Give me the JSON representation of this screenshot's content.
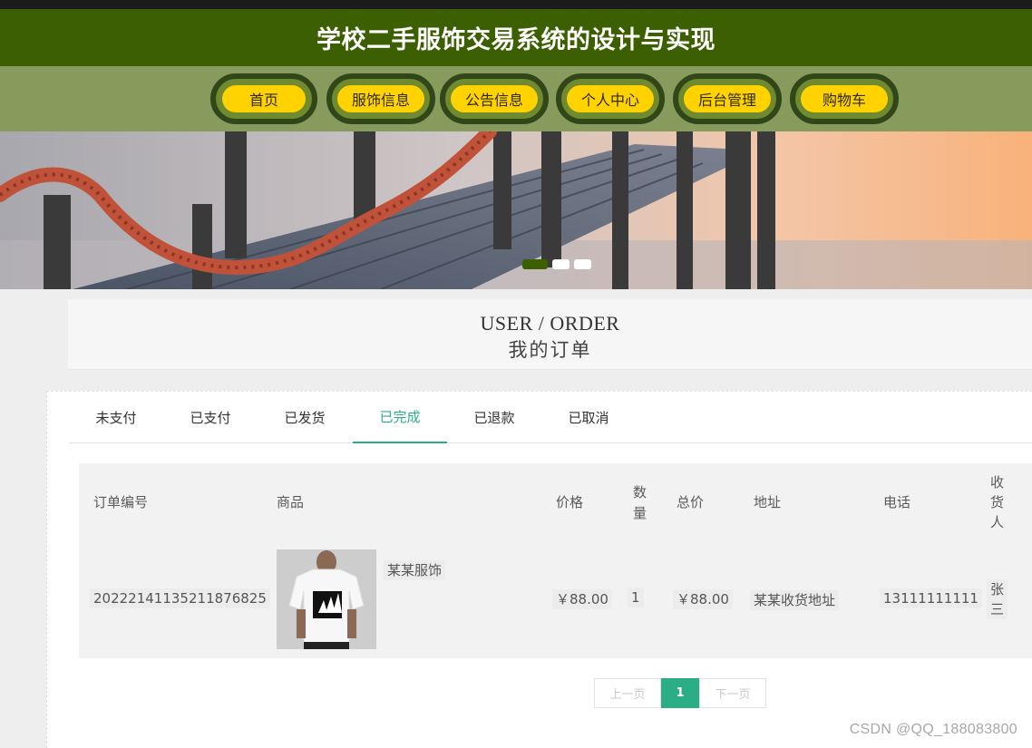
{
  "header": {
    "title": "学校二手服饰交易系统的设计与实现"
  },
  "nav": [
    "首页",
    "服饰信息",
    "公告信息",
    "个人中心",
    "后台管理",
    "购物车"
  ],
  "banner": {
    "dots": [
      {
        "active": true
      },
      {
        "active": false
      },
      {
        "active": false
      }
    ]
  },
  "section": {
    "en": "USER / ORDER",
    "cn": "我的订单"
  },
  "tabs": {
    "items": [
      "未支付",
      "已支付",
      "已发货",
      "已完成",
      "已退款",
      "已取消"
    ],
    "active": "已完成"
  },
  "table": {
    "headers": {
      "order_no": "订单编号",
      "product": "商品",
      "price": "价格",
      "qty_a": "数",
      "qty_b": "量",
      "total": "总价",
      "address": "地址",
      "phone": "电话",
      "rcv_a": "收",
      "rcv_b": "货",
      "rcv_c": "人"
    },
    "row": {
      "order_no": "20222141135211876825",
      "product_name": "某某服饰",
      "price": "￥88.00",
      "qty": "1",
      "total": "￥88.00",
      "address": "某某收货地址",
      "phone": "13111111111",
      "receiver_a": "张",
      "receiver_b": "三"
    }
  },
  "pagination": {
    "prev": "上一页",
    "current": "1",
    "next": "下一页"
  },
  "watermark": "CSDN @QQ_188083800",
  "colors": {
    "header": "#3c5f02",
    "nav_pill": "#ffd200",
    "accent": "#2bad86"
  }
}
